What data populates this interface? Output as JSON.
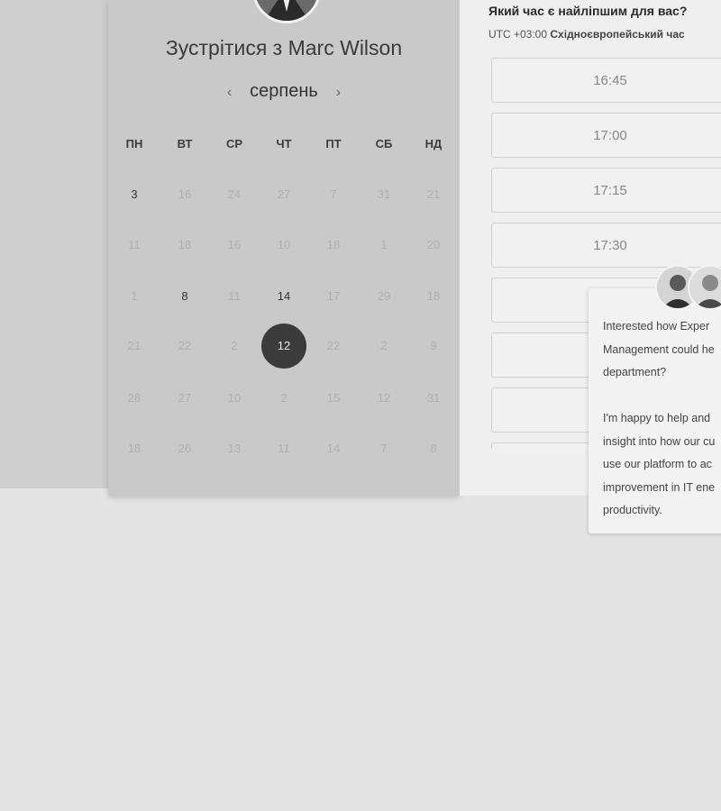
{
  "host": {
    "meet_title": "Зустрітися з Marc Wilson"
  },
  "calendar": {
    "month": "серпень",
    "prev_icon": "chevron-left-icon",
    "next_icon": "chevron-right-icon",
    "weekdays": [
      "ПН",
      "ВТ",
      "СР",
      "ЧТ",
      "ПТ",
      "СБ",
      "НД"
    ],
    "weeks": [
      [
        {
          "d": "3",
          "available": true
        },
        {
          "d": "16",
          "available": false
        },
        {
          "d": "24",
          "available": false
        },
        {
          "d": "27",
          "available": false
        },
        {
          "d": "7",
          "available": false
        },
        {
          "d": "31",
          "available": false
        },
        {
          "d": "21",
          "available": false
        }
      ],
      [
        {
          "d": "11",
          "available": false
        },
        {
          "d": "18",
          "available": false
        },
        {
          "d": "16",
          "available": false
        },
        {
          "d": "10",
          "available": false
        },
        {
          "d": "18",
          "available": false
        },
        {
          "d": "1",
          "available": false
        },
        {
          "d": "20",
          "available": false
        }
      ],
      [
        {
          "d": "1",
          "available": false
        },
        {
          "d": "8",
          "available": true
        },
        {
          "d": "11",
          "available": false
        },
        {
          "d": "14",
          "available": true
        },
        {
          "d": "17",
          "available": false
        },
        {
          "d": "29",
          "available": false
        },
        {
          "d": "18",
          "available": false
        }
      ],
      [
        {
          "d": "21",
          "available": false
        },
        {
          "d": "22",
          "available": false
        },
        {
          "d": "2",
          "available": false
        },
        {
          "d": "12",
          "available": true,
          "selected": true
        },
        {
          "d": "22",
          "available": false
        },
        {
          "d": "2",
          "available": false
        },
        {
          "d": "9",
          "available": false
        }
      ],
      [
        {
          "d": "28",
          "available": false
        },
        {
          "d": "27",
          "available": false
        },
        {
          "d": "10",
          "available": false
        },
        {
          "d": "2",
          "available": false
        },
        {
          "d": "15",
          "available": false
        },
        {
          "d": "12",
          "available": false
        },
        {
          "d": "31",
          "available": false
        }
      ],
      [
        {
          "d": "18",
          "available": false
        },
        {
          "d": "26",
          "available": false
        },
        {
          "d": "13",
          "available": false
        },
        {
          "d": "11",
          "available": false
        },
        {
          "d": "14",
          "available": false
        },
        {
          "d": "7",
          "available": false
        },
        {
          "d": "8",
          "available": false
        }
      ]
    ]
  },
  "times": {
    "question": "Який час є найліпшим для вас?",
    "tz_offset": "UTC +03:00",
    "tz_name": "Східноєвропейський час",
    "slots": [
      "16:45",
      "17:00",
      "17:15",
      "17:30",
      "",
      "",
      "",
      ""
    ]
  },
  "chat": {
    "message": "Interested how Exper\nManagement could he\ndepartment?\n\nI'm happy to help and\ninsight into how our cu\nuse our platform to ac\nimprovement in IT ene\nproductivity.",
    "avatars": [
      "agent-avatar-1",
      "agent-avatar-2"
    ]
  }
}
